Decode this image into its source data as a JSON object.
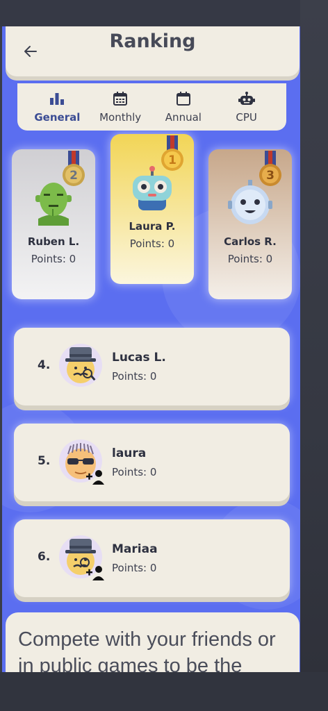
{
  "header": {
    "title": "Ranking",
    "back_icon": "arrow-left-icon"
  },
  "tabs": [
    {
      "label": "General",
      "icon": "bar-chart-icon",
      "active": true
    },
    {
      "label": "Monthly",
      "icon": "calendar-grid-icon",
      "active": false
    },
    {
      "label": "Annual",
      "icon": "calendar-icon",
      "active": false
    },
    {
      "label": "CPU",
      "icon": "robot-icon",
      "active": false
    }
  ],
  "podium": [
    {
      "place": "2",
      "name": "Ruben L.",
      "points": "Points: 0",
      "avatar": "zombie-avatar",
      "medal_color": "#c8a44a"
    },
    {
      "place": "1",
      "name": "Laura P.",
      "points": "Points: 0",
      "avatar": "robot-avatar",
      "medal_color": "#f0b63a"
    },
    {
      "place": "3",
      "name": "Carlos R.",
      "points": "Points: 0",
      "avatar": "robot-blue-avatar",
      "medal_color": "#d19a3c"
    }
  ],
  "list": [
    {
      "rank": "4.",
      "name": "Lucas L.",
      "points": "Points: 0",
      "avatar": "detective-avatar",
      "add_friend": false
    },
    {
      "rank": "5.",
      "name": "laura",
      "points": "Points: 0",
      "avatar": "sunglasses-avatar",
      "add_friend": true
    },
    {
      "rank": "6.",
      "name": "Mariaa",
      "points": "Points: 0",
      "avatar": "detective-avatar",
      "add_friend": true
    }
  ],
  "footer": {
    "text": "Compete with your friends or in public games to be the best."
  },
  "colors": {
    "background": "#5b6ef0",
    "card": "#f1ede3",
    "active_tab": "#3b4c94"
  }
}
